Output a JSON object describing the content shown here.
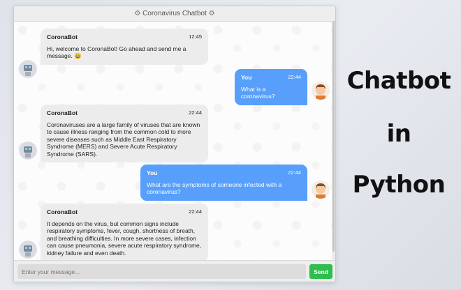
{
  "window": {
    "title": "Coronavirus Chatbot",
    "title_icon": "virus-icon"
  },
  "messages": [
    {
      "side": "bot",
      "name": "CoronaBot",
      "time": "12:45",
      "text": "Hi, welcome to CoronaBot! Go ahead and send me a message. 😄"
    },
    {
      "side": "user",
      "name": "You",
      "time": "22:44",
      "text": "What is a coronavirus?"
    },
    {
      "side": "bot",
      "name": "CoronaBot",
      "time": "22:44",
      "text": "Coronaviruses are a large family of viruses that are known to cause illness ranging from the common cold to more severe diseases such as Middle East Respiratory Syndrome (MERS) and Severe Acute Respiratory Syndrome (SARS)."
    },
    {
      "side": "user",
      "name": "You",
      "time": "22:44",
      "text": "What are the symptoms of someone infected with a coronavirus?"
    },
    {
      "side": "bot",
      "name": "CoronaBot",
      "time": "22:44",
      "text": "It depends on the virus, but common signs include respiratory symptoms, fever, cough, shortness of breath, and breathing difficulties. In more severe cases, infection can cause pneumonia, severe acute respiratory syndrome, kidney failure and even death."
    }
  ],
  "input": {
    "placeholder": "Enter your message...",
    "value": ""
  },
  "send_label": "Send",
  "side_title": {
    "line1": "Chatbot",
    "line2": "in",
    "line3": "Python"
  },
  "colors": {
    "user_bubble": "#579ffb",
    "bot_bubble": "#ececec",
    "send_button": "#2ebd4f"
  }
}
